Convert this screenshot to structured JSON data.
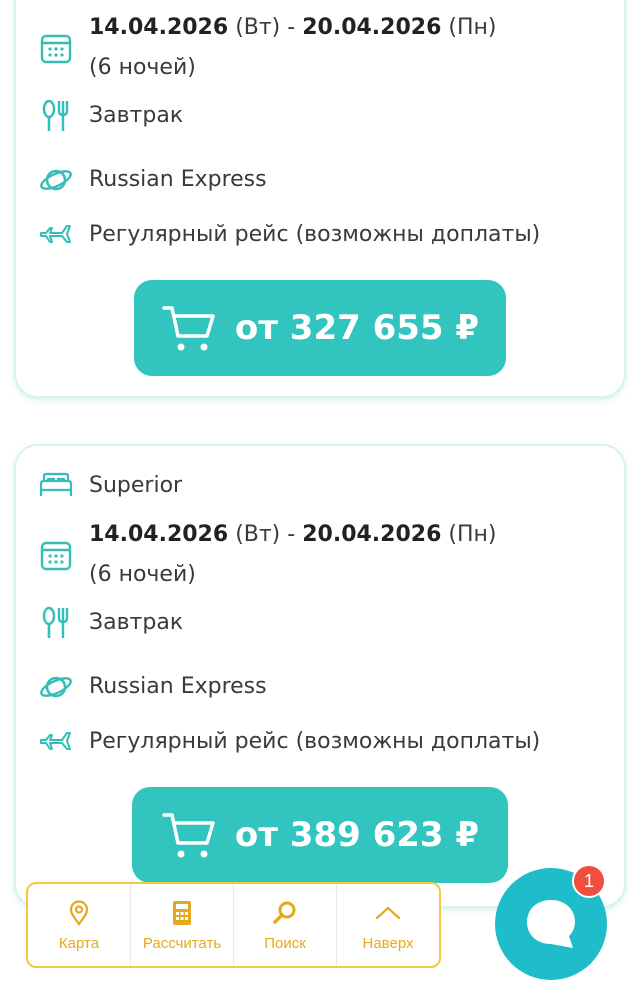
{
  "colors": {
    "accent": "#32c4be",
    "icon": "#35bdb7",
    "nav_accent": "#e5a91e",
    "nav_border": "#f5c842",
    "chat": "#1fbcc9",
    "badge": "#f04e3e"
  },
  "offers": [
    {
      "date_from": "14.04.2026",
      "day_from": "(Вт)",
      "separator": "-",
      "date_to": "20.04.2026",
      "day_to": "(Пн)",
      "nights": "(6 ночей)",
      "meal": "Завтрак",
      "operator": "Russian Express",
      "flight": "Регулярный рейс (возможны доплаты)",
      "price": "от 327 655 ₽"
    },
    {
      "room": "Superior",
      "date_from": "14.04.2026",
      "day_from": "(Вт)",
      "separator": "-",
      "date_to": "20.04.2026",
      "day_to": "(Пн)",
      "nights": "(6 ночей)",
      "meal": "Завтрак",
      "operator": "Russian Express",
      "flight": "Регулярный рейс (возможны доплаты)",
      "price": "от 389 623 ₽"
    }
  ],
  "bottom_nav": [
    {
      "label": "Карта",
      "icon": "map-pin-icon"
    },
    {
      "label": "Рассчитать",
      "icon": "calculator-icon"
    },
    {
      "label": "Поиск",
      "icon": "search-icon"
    },
    {
      "label": "Наверх",
      "icon": "chevron-up-icon"
    }
  ],
  "chat": {
    "badge_count": "1",
    "icon": "chat-bubble-icon"
  }
}
